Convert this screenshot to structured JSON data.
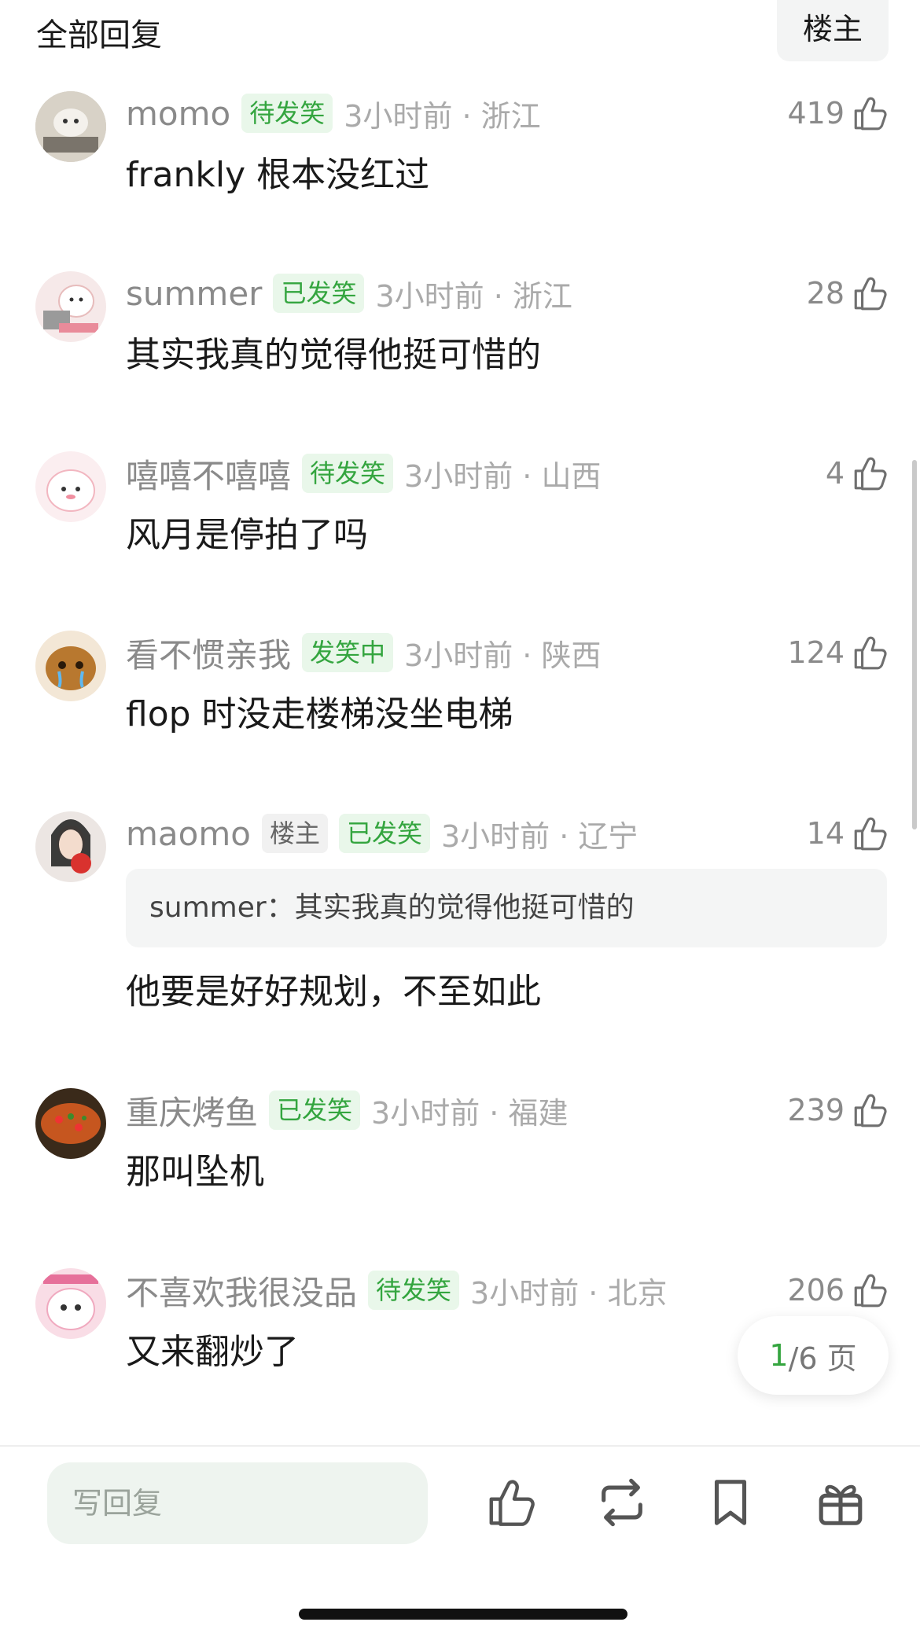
{
  "header": {
    "title": "全部回复",
    "op_tab": "楼主"
  },
  "comments": [
    {
      "username": "momo",
      "tags": [
        {
          "label": "待发笑",
          "style": "green"
        }
      ],
      "time": "3小时前 · 浙江",
      "likes": "419",
      "text": "frankly 根本没红过",
      "avatar": "avatar-photo-dog-icon"
    },
    {
      "username": "summer",
      "tags": [
        {
          "label": "已发笑",
          "style": "green"
        }
      ],
      "time": "3小时前 · 浙江",
      "likes": "28",
      "text": "其实我真的觉得他挺可惜的",
      "avatar": "avatar-cartoon-laptop-icon"
    },
    {
      "username": "嘻嘻不嘻嘻",
      "tags": [
        {
          "label": "待发笑",
          "style": "green"
        }
      ],
      "time": "3小时前 · 山西",
      "likes": "4",
      "text": "风月是停拍了吗",
      "avatar": "avatar-pink-blob-icon"
    },
    {
      "username": "看不惯亲我",
      "tags": [
        {
          "label": "发笑中",
          "style": "green"
        }
      ],
      "time": "3小时前 · 陕西",
      "likes": "124",
      "text": "flop 时没走楼梯没坐电梯",
      "avatar": "avatar-crying-bear-icon"
    },
    {
      "username": "maomo",
      "tags": [
        {
          "label": "楼主",
          "style": "grey"
        },
        {
          "label": "已发笑",
          "style": "green"
        }
      ],
      "time": "3小时前 · 辽宁",
      "likes": "14",
      "quote": "summer：其实我真的觉得他挺可惜的",
      "text": "他要是好好规划，不至如此",
      "avatar": "avatar-woman-apple-icon"
    },
    {
      "username": "重庆烤鱼",
      "tags": [
        {
          "label": "已发笑",
          "style": "green"
        }
      ],
      "time": "3小时前 · 福建",
      "likes": "239",
      "text": "那叫坠机",
      "avatar": "avatar-grilled-fish-icon"
    },
    {
      "username": "不喜欢我很没品",
      "tags": [
        {
          "label": "待发笑",
          "style": "green"
        }
      ],
      "time": "3小时前 · 北京",
      "likes": "206",
      "text": "又来翻炒了",
      "avatar": "avatar-pink-cartoon-icon"
    }
  ],
  "pager": {
    "current": "1",
    "total": "/6 页"
  },
  "bottom_bar": {
    "reply_placeholder": "写回复",
    "icons": [
      "thumbs-up-icon",
      "repost-icon",
      "bookmark-icon",
      "gift-icon"
    ]
  },
  "colors": {
    "accent_green": "#34a53f",
    "tag_green_bg": "#e9f7ea",
    "meta_grey": "#8a8a8a"
  }
}
